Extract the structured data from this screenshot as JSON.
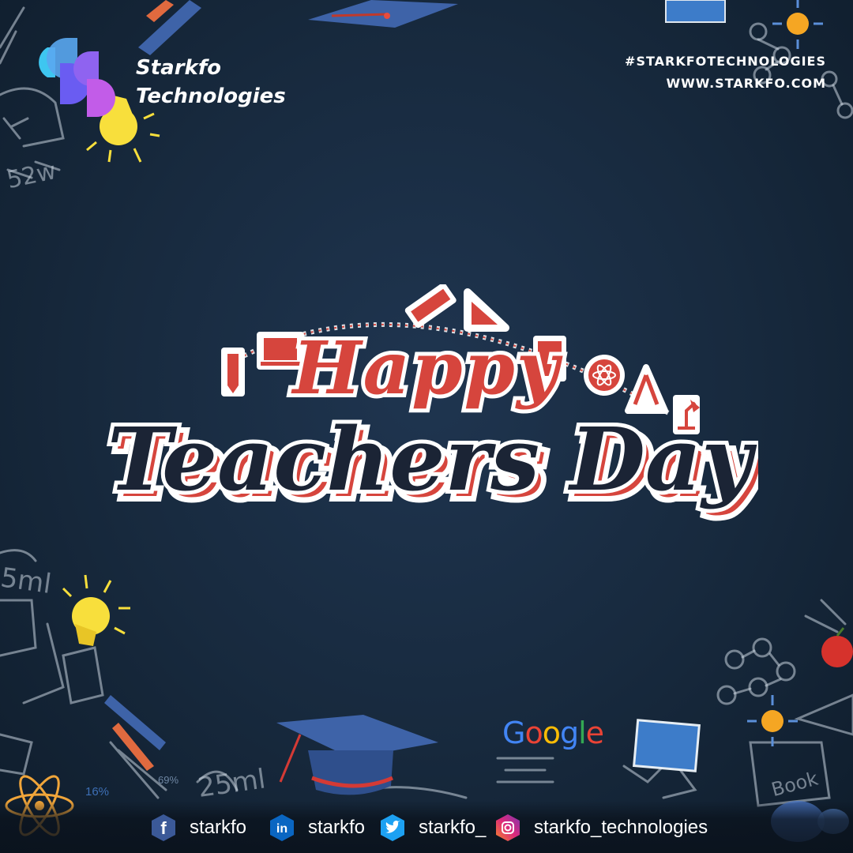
{
  "brand": {
    "line1": "Starkfo",
    "line2": "Technologies",
    "logo_colors": [
      "#3ec6f0",
      "#6a5cf2",
      "#c25ce8"
    ]
  },
  "header": {
    "hashtag": "#STARKFOTECHNOLOGIES",
    "website": "WWW.STARKFO.COM"
  },
  "headline": {
    "line1": "Happy",
    "line2": "Teachers Day",
    "accent_color": "#d6453d",
    "dark_color": "#1b2435",
    "outline_color": "#ffffff"
  },
  "decor": {
    "google_text": "Google",
    "google_colors": [
      "#4285f4",
      "#ea4335",
      "#fbbc05",
      "#4285f4",
      "#34a853",
      "#ea4335"
    ],
    "percent_left": "16%",
    "percent_mid": "69%",
    "chalk_text_1": "5ml",
    "chalk_text_2": "25ml",
    "chalk_text_3": "Book"
  },
  "social": [
    {
      "icon": "facebook-icon",
      "label": "starkfo",
      "color": "#3b5998"
    },
    {
      "icon": "linkedin-icon",
      "label": "starkfo",
      "color": "#0a66c2"
    },
    {
      "icon": "twitter-icon",
      "label": "starkfo_",
      "color": "#1da1f2"
    },
    {
      "icon": "instagram-icon",
      "label": "starkfo_technologies",
      "color": "#c13584"
    }
  ]
}
